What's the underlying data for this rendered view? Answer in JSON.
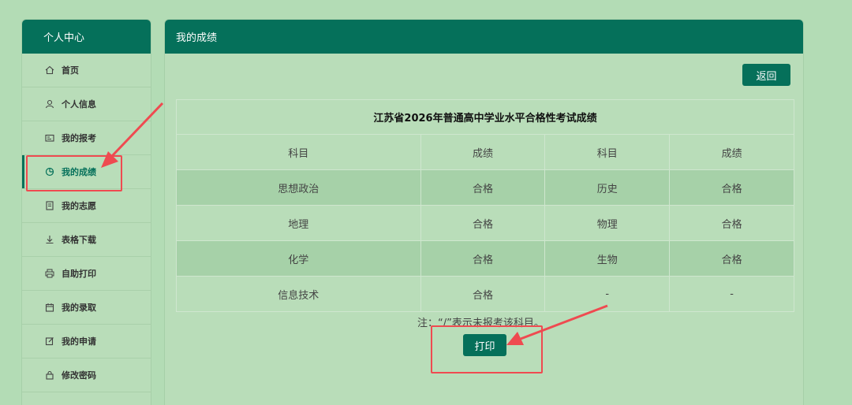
{
  "sidebar": {
    "title": "个人中心",
    "items": [
      {
        "label": "首页",
        "icon": "home-icon"
      },
      {
        "label": "个人信息",
        "icon": "user-icon"
      },
      {
        "label": "我的报考",
        "icon": "id-card-icon"
      },
      {
        "label": "我的成绩",
        "icon": "chart-icon"
      },
      {
        "label": "我的志愿",
        "icon": "document-icon"
      },
      {
        "label": "表格下载",
        "icon": "download-icon"
      },
      {
        "label": "自助打印",
        "icon": "printer-icon"
      },
      {
        "label": "我的录取",
        "icon": "calendar-icon"
      },
      {
        "label": "我的申请",
        "icon": "edit-icon"
      },
      {
        "label": "修改密码",
        "icon": "lock-icon"
      }
    ],
    "active_index": 3
  },
  "main": {
    "header": "我的成绩",
    "back_label": "返回",
    "table_title": "江苏省2026年普通高中学业水平合格性考试成绩",
    "columns": [
      "科目",
      "成绩",
      "科目",
      "成绩"
    ],
    "rows": [
      [
        "思想政治",
        "合格",
        "历史",
        "合格"
      ],
      [
        "地理",
        "合格",
        "物理",
        "合格"
      ],
      [
        "化学",
        "合格",
        "生物",
        "合格"
      ],
      [
        "信息技术",
        "合格",
        "-",
        "-"
      ]
    ],
    "note": "注：“/”表示未报考该科目。",
    "print_label": "打印"
  },
  "colors": {
    "brand": "#05705a",
    "highlight": "#ef4a50",
    "background": "#b3dcb5"
  }
}
